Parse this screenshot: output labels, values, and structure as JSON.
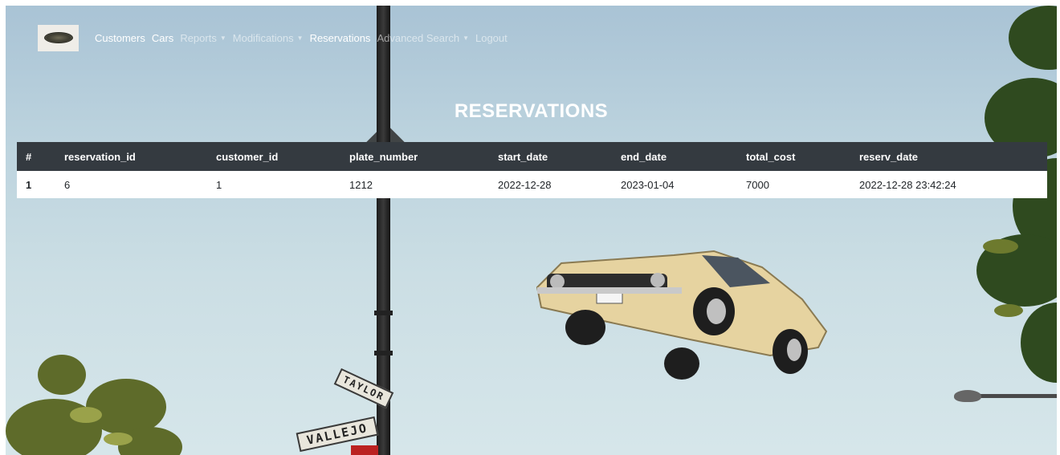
{
  "navbar": {
    "items": [
      {
        "label": "Customers",
        "dropdown": false,
        "active": true
      },
      {
        "label": "Cars",
        "dropdown": false,
        "active": true
      },
      {
        "label": "Reports",
        "dropdown": true,
        "active": false
      },
      {
        "label": "Modifications",
        "dropdown": true,
        "active": false
      },
      {
        "label": "Reservations",
        "dropdown": false,
        "active": true
      },
      {
        "label": "Advanced Search",
        "dropdown": true,
        "active": false
      },
      {
        "label": "Logout",
        "dropdown": false,
        "active": false
      }
    ],
    "brand_icon": "car-logo-icon"
  },
  "page": {
    "title": "RESERVATIONS"
  },
  "table": {
    "headers": [
      "#",
      "reservation_id",
      "customer_id",
      "plate_number",
      "start_date",
      "end_date",
      "total_cost",
      "reserv_date"
    ],
    "rows": [
      [
        "1",
        "6",
        "1",
        "1212",
        "2022-12-28",
        "2023-01-04",
        "7000",
        "2022-12-28 23:42:24"
      ]
    ]
  },
  "scenery": {
    "signs": [
      "TAYLOR",
      "VALLEJO"
    ]
  },
  "colors": {
    "table_header_bg": "#343a40",
    "table_row_bg": "#ffffff",
    "nav_active": "#ffffff"
  }
}
